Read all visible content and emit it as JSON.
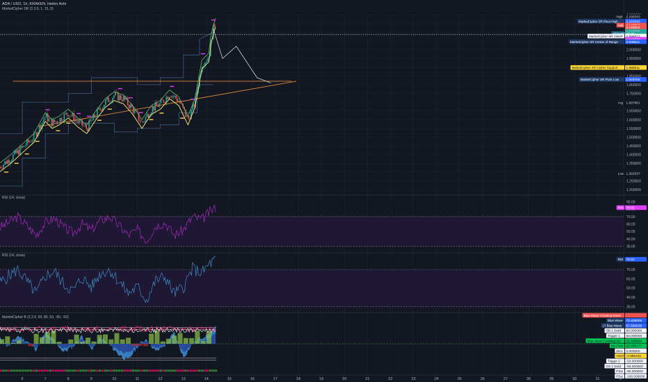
{
  "header": {
    "symbol_line": "ADA / USD, 1h, KRAKEN, Heikin Ashi",
    "indicator_line": "MarketCipher SR (2.2.0, 1, 15, 0)"
  },
  "colors": {
    "background": "#131722",
    "grid": "#1f2330",
    "separator": "#2a2e39",
    "bull": "#26a69a",
    "bear": "#ef5350",
    "rsi": "#9c27b0",
    "rsi2": "#3d7fb5",
    "band_fill": "#1e1834",
    "pivot_high": "#e040fb",
    "pivot_low": "#ffd54f",
    "orange_line": "#e08a3c",
    "blue_wave": "#3f8fd8",
    "channel": "#3d5f85"
  },
  "chart_data": [
    {
      "name": "ADA/USD price",
      "type": "candlestick",
      "y_ticks": [
        "2.200000",
        "2.150000",
        "2.100000",
        "2.050000",
        "2.000000",
        "1.950000",
        "1.900000",
        "1.850000",
        "1.800000",
        "1.750000",
        "1.700000",
        "1.650000",
        "1.600000",
        "1.550000",
        "1.500000",
        "1.450000",
        "1.400000",
        "1.350000",
        "1.300000",
        "1.250000",
        "1.200000"
      ],
      "ylim": [
        1.18,
        2.205
      ],
      "x_ticks": [
        "6",
        "7",
        "8",
        "9",
        "10",
        "11",
        "12",
        "13",
        "14",
        "15",
        "16",
        "17",
        "18",
        "19",
        "20",
        "21",
        "22",
        "23",
        "24",
        "25",
        "26",
        "27",
        "28",
        "29",
        "30",
        "31",
        "2"
      ],
      "close_path": {
        "x": [
          0,
          0.5,
          1,
          1.5,
          2,
          2.3,
          2.6,
          3,
          3.4,
          3.8,
          4.2,
          4.6,
          5,
          5.4,
          5.8,
          6.2,
          6.6,
          7,
          7.4,
          7.8,
          8.2,
          8.5,
          8.8,
          9.1,
          9.2,
          9.3,
          9.4
        ],
        "y": [
          1.33,
          1.38,
          1.44,
          1.5,
          1.62,
          1.58,
          1.6,
          1.64,
          1.59,
          1.55,
          1.63,
          1.7,
          1.74,
          1.72,
          1.66,
          1.58,
          1.66,
          1.69,
          1.75,
          1.71,
          1.6,
          1.7,
          1.92,
          1.96,
          2.06,
          2.12,
          2.16
        ]
      },
      "channel_upper": {
        "x": [
          0,
          1,
          1,
          3,
          3,
          4,
          4,
          5,
          5,
          6,
          6,
          7,
          7,
          8,
          8,
          8.7,
          8.7,
          9.3
        ],
        "y": [
          1.52,
          1.52,
          1.7,
          1.7,
          1.75,
          1.75,
          1.84,
          1.84,
          1.84,
          1.84,
          1.8,
          1.8,
          1.84,
          1.84,
          1.97,
          1.97,
          2.06,
          2.1
        ]
      },
      "channel_lower": {
        "x": [
          0,
          1,
          1,
          2,
          2,
          3,
          3,
          5,
          5,
          6,
          6,
          7,
          7,
          7.8,
          7.8,
          8.6,
          8.6,
          9.3
        ],
        "y": [
          1.22,
          1.22,
          1.38,
          1.38,
          1.52,
          1.52,
          1.58,
          1.58,
          1.53,
          1.53,
          1.55,
          1.55,
          1.57,
          1.57,
          1.64,
          1.64,
          1.8,
          1.8
        ]
      },
      "projection": {
        "x": [
          9.3,
          9.7,
          10.3,
          11.2,
          11.8
        ],
        "y": [
          2.12,
          1.95,
          2.02,
          1.84,
          1.81
        ]
      },
      "horizontal_level": {
        "y": 1.82,
        "x_start": 0.6,
        "x_end": 12.7
      },
      "trendline": {
        "x": [
          1.7,
          12.9
        ],
        "y": [
          1.56,
          1.82
        ]
      },
      "dotted_level": 2.086517,
      "labels": [
        {
          "text": "High",
          "value": "2.189343",
          "y": 2.189343,
          "style": "plain"
        },
        {
          "text": "MarketCipher SR Pivot High",
          "value": "2.163343",
          "y": 2.163343,
          "style": "blue"
        },
        {
          "text": "Ask",
          "value": "2.140824",
          "y": 2.140824,
          "style": "red"
        },
        {
          "text": "",
          "value": "2.140824",
          "y": 2.128,
          "style": "red"
        },
        {
          "text": "",
          "value": "2.117380",
          "y": 2.105,
          "style": "teal"
        },
        {
          "text": "ADAUSD",
          "value": "47:40",
          "y": 2.092,
          "style": "teal"
        },
        {
          "text": "MarketCipher SR VWAP",
          "value": "2.086517",
          "y": 2.078,
          "style": "white"
        },
        {
          "text": "",
          "value": "2.047570",
          "y": 2.06,
          "style": "magenta"
        },
        {
          "text": "MarketCipher SR Center of Range",
          "value": "2.008511",
          "y": 2.046,
          "style": "blue"
        },
        {
          "text": "MarketCipher SR Cipher Support",
          "value": "1.898511",
          "y": 1.898511,
          "style": "yellow"
        },
        {
          "text": "MarketCipher SR Pivot Low",
          "value": "1.829766",
          "y": 1.829766,
          "style": "blue"
        },
        {
          "text": "Avg",
          "value": "1.697861",
          "y": 1.697861,
          "style": "plain"
        },
        {
          "text": "Low",
          "value": "1.293337",
          "y": 1.293337,
          "style": "plain"
        }
      ]
    },
    {
      "name": "RSI pane 1",
      "type": "line",
      "title": "RSI (14, close)",
      "y_ticks": [
        "90.00",
        "80.00",
        "70.00",
        "60.00",
        "50.00",
        "40.00",
        "30.00"
      ],
      "ylim": [
        25,
        95
      ],
      "band": [
        30,
        70
      ],
      "last_label": {
        "text": "RSI",
        "value": "78.02"
      },
      "x": [
        0,
        0.4,
        0.8,
        1.2,
        1.6,
        2,
        2.4,
        2.8,
        3.2,
        3.6,
        4,
        4.4,
        4.8,
        5.2,
        5.6,
        6,
        6.4,
        6.8,
        7.2,
        7.6,
        8,
        8.4,
        8.8,
        9.1,
        9.4
      ],
      "y": [
        55,
        62,
        70,
        58,
        45,
        62,
        68,
        55,
        48,
        60,
        52,
        65,
        70,
        58,
        45,
        52,
        38,
        58,
        62,
        45,
        52,
        70,
        66,
        75,
        82
      ]
    },
    {
      "name": "RSI pane 2",
      "type": "line",
      "title": "RSI (14, close)",
      "y_ticks": [
        "80.00",
        "70.00",
        "60.00",
        "50.00",
        "40.00",
        "30.00"
      ],
      "ylim": [
        25,
        85
      ],
      "band": [
        30,
        70
      ],
      "last_label": {
        "text": "RSI",
        "value": "78.02"
      },
      "x": [
        0,
        0.4,
        0.8,
        1.2,
        1.6,
        2,
        2.4,
        2.8,
        3.2,
        3.6,
        4,
        4.4,
        4.8,
        5.2,
        5.6,
        6,
        6.4,
        6.8,
        7.2,
        7.6,
        8,
        8.4,
        8.8,
        9.1,
        9.4
      ],
      "y": [
        55,
        63,
        70,
        57,
        44,
        63,
        68,
        54,
        47,
        61,
        51,
        66,
        70,
        57,
        44,
        51,
        37,
        58,
        62,
        44,
        51,
        71,
        66,
        75,
        81
      ]
    },
    {
      "name": "MarketCipher B",
      "type": "area",
      "title": "MarketCipher B (2.2.0, 60, 80, 53, -60, -53)",
      "wave": {
        "x": [
          0,
          0.4,
          0.8,
          1.2,
          1.6,
          2,
          2.4,
          2.8,
          3.2,
          3.6,
          4,
          4.4,
          4.8,
          5.2,
          5.6,
          6,
          6.4,
          6.8,
          7.2,
          7.6,
          8,
          8.4,
          8.8,
          9.1,
          9.4
        ],
        "y": [
          20,
          -10,
          30,
          10,
          -20,
          40,
          10,
          -30,
          -10,
          30,
          -20,
          20,
          -5,
          -40,
          -60,
          -10,
          20,
          -30,
          -5,
          40,
          -50,
          0,
          25,
          35,
          60
        ]
      },
      "labels": [
        {
          "text": "Blue Wave Crossing Down",
          "value": "",
          "style": "red"
        },
        {
          "text": "Blue Wave",
          "value": "70.409005",
          "style": "blue"
        },
        {
          "text": "LT Blue Wave",
          "value": "67.650638",
          "style": "blue"
        },
        {
          "text": "OB 1 Solid",
          "value": "60.000000",
          "style": "white"
        },
        {
          "text": "Trigger 1",
          "value": "53.000000",
          "style": "white"
        },
        {
          "text": "Blue Wave Crossing Up",
          "value": "32.836894",
          "style": "green"
        },
        {
          "text": "Mo Flow",
          "value": "32.385177",
          "style": "green"
        },
        {
          "text": "Zero",
          "value": "0.000000",
          "style": "white"
        },
        {
          "text": "VWAP",
          "value": "-2.996432",
          "style": "yellow"
        },
        {
          "text": "Trigger 2",
          "value": "-53.000000",
          "style": "white"
        },
        {
          "text": "OS 1 Solid",
          "value": "-60.000000",
          "style": "white"
        },
        {
          "text": "PSst",
          "value": "-90.000000",
          "style": "white"
        },
        {
          "text": "PSst",
          "value": "-100.000000",
          "style": "white"
        }
      ]
    }
  ]
}
